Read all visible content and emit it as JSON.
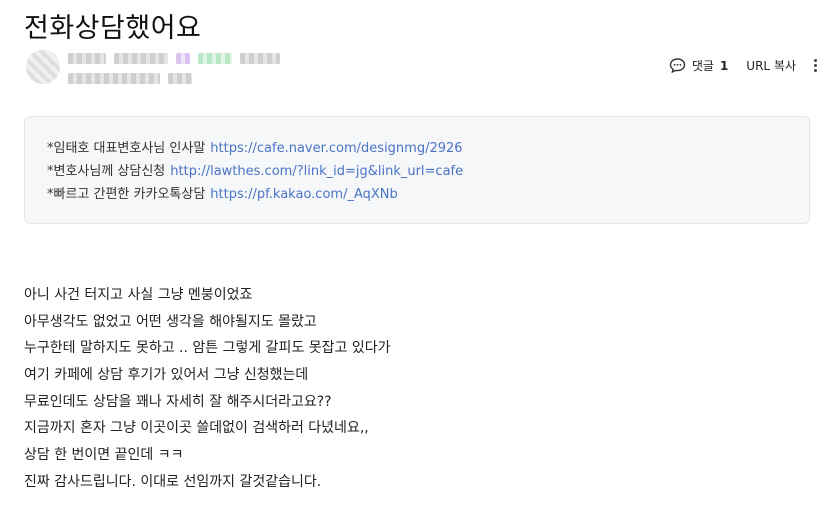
{
  "post": {
    "title": "전화상담했어요"
  },
  "toolbar": {
    "comment_label": "댓글",
    "comment_count": "1",
    "url_copy_label": "URL 복사"
  },
  "info_box": {
    "lines": [
      {
        "label": "*임태호 대표변호사님 인사말",
        "link": "https://cafe.naver.com/designmg/2926"
      },
      {
        "label": "*변호사님께 상담신청",
        "link": "http://lawthes.com/?link_id=jg&link_url=cafe"
      },
      {
        "label": "*빠르고 간편한 카카오톡상담",
        "link": "https://pf.kakao.com/_AqXNb"
      }
    ]
  },
  "content": {
    "lines": [
      "아니 사건 터지고 사실 그냥 멘붕이었죠",
      "아무생각도 없었고 어떤 생각을 해야될지도 몰랐고",
      "누구한테 말하지도 못하고 .. 암튼 그렇게 갈피도 못잡고 있다가",
      "여기 카페에 상담 후기가 있어서 그냥 신청했는데",
      "무료인데도 상담을 꽤나 자세히 잘 해주시더라고요??",
      "지금까지 혼자 그냥 이곳이곳 쓸데없이 검색하러 다녔네요,,",
      "상담 한 번이면 끝인데 ㅋㅋ",
      "진짜 감사드립니다. 이대로 선임까지 갈것같습니다."
    ]
  }
}
